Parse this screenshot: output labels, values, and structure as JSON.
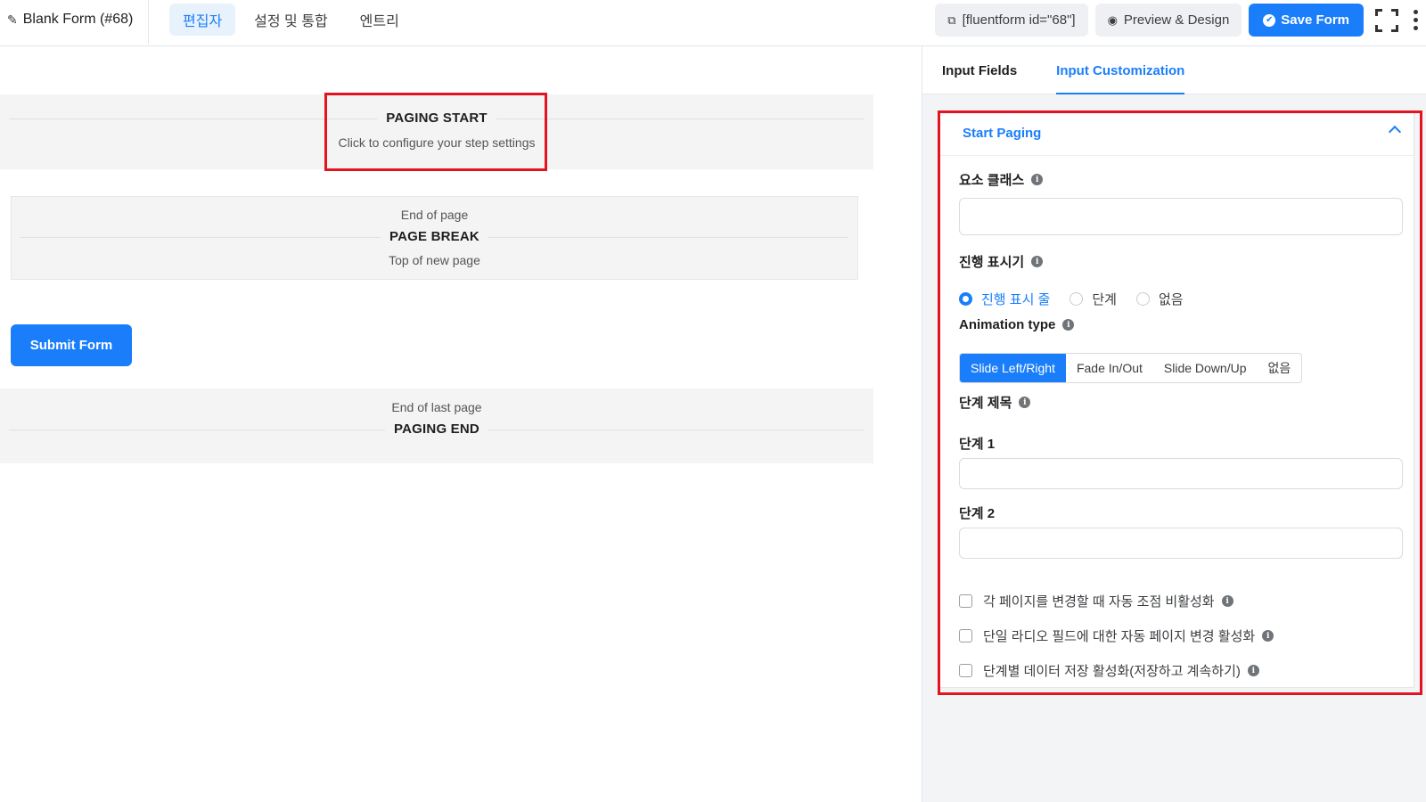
{
  "header": {
    "form_title": "Blank Form (#68)",
    "tabs": [
      {
        "label": "편집자",
        "active": true
      },
      {
        "label": "설정 및 통합",
        "active": false
      },
      {
        "label": "엔트리",
        "active": false
      }
    ],
    "shortcode": "[fluentform id=\"68\"]",
    "preview_label": "Preview & Design",
    "save_label": "Save Form",
    "accent": "#1a7efb"
  },
  "canvas": {
    "paging_start": {
      "title": "PAGING START",
      "subtitle": "Click to configure your step settings"
    },
    "page_break": {
      "top": "End of page",
      "title": "PAGE BREAK",
      "bottom": "Top of new page"
    },
    "submit_label": "Submit Form",
    "paging_end": {
      "top": "End of last page",
      "title": "PAGING END"
    }
  },
  "panel": {
    "tabs": [
      {
        "label": "Input Fields",
        "active": false
      },
      {
        "label": "Input Customization",
        "active": true
      }
    ],
    "section_title": "Start Paging",
    "element_class_label": "요소 클래스",
    "element_class_value": "",
    "progress_label": "진행 표시기",
    "progress_options": [
      {
        "label": "진행 표시 줄",
        "selected": true
      },
      {
        "label": "단계",
        "selected": false
      },
      {
        "label": "없음",
        "selected": false
      }
    ],
    "animation_label": "Animation type",
    "animation_options": [
      {
        "label": "Slide Left/Right",
        "selected": true
      },
      {
        "label": "Fade In/Out",
        "selected": false
      },
      {
        "label": "Slide Down/Up",
        "selected": false
      },
      {
        "label": "없음",
        "selected": false
      }
    ],
    "step_titles_label": "단계 제목",
    "step1_label": "단계 1",
    "step1_value": "",
    "step2_label": "단계 2",
    "step2_value": "",
    "checkboxes": [
      {
        "label": "각 페이지를 변경할 때 자동 조점 비활성화",
        "checked": false
      },
      {
        "label": "단일 라디오 필드에 대한 자동 페이지 변경 활성화",
        "checked": false
      },
      {
        "label": "단계별 데이터 저장 활성화(저장하고 계속하기)",
        "checked": false
      }
    ]
  },
  "highlight_color": "#e3141f"
}
